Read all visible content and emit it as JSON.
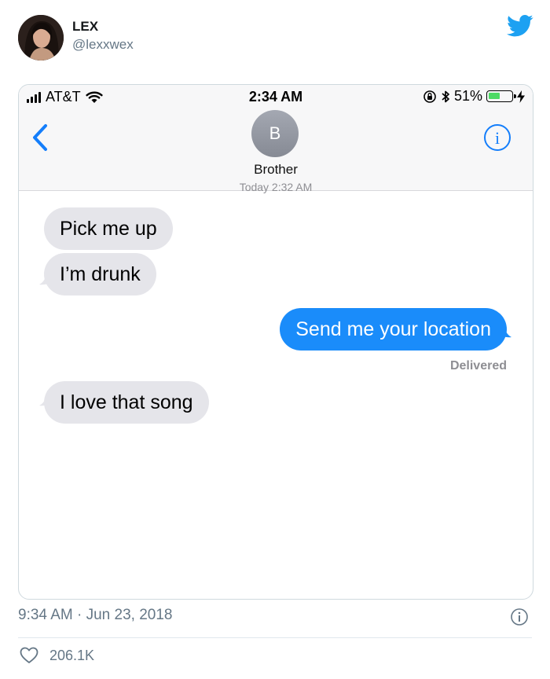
{
  "author": {
    "name": "LEX",
    "handle": "@lexxwex"
  },
  "phone": {
    "carrier": "AT&T",
    "time": "2:34 AM",
    "battery": "51%",
    "battery_level": 0.51,
    "contact_initial": "B",
    "contact_name": "Brother",
    "thread_timestamp": "Today 2:32 AM",
    "messages": [
      {
        "text": "Pick me up",
        "direction": "incoming"
      },
      {
        "text": "I’m drunk",
        "direction": "incoming"
      },
      {
        "text": "Send me your location",
        "direction": "outgoing"
      },
      {
        "text": "I love that song",
        "direction": "incoming"
      }
    ],
    "delivered_label": "Delivered"
  },
  "tweet": {
    "timestamp": "9:34 AM · Jun 23, 2018",
    "likes": "206.1K"
  },
  "colors": {
    "twitter_blue": "#1da1f2",
    "imessage_blue": "#1a8cfa",
    "incoming_gray": "#e5e5ea",
    "ios_blue": "#147efb"
  }
}
